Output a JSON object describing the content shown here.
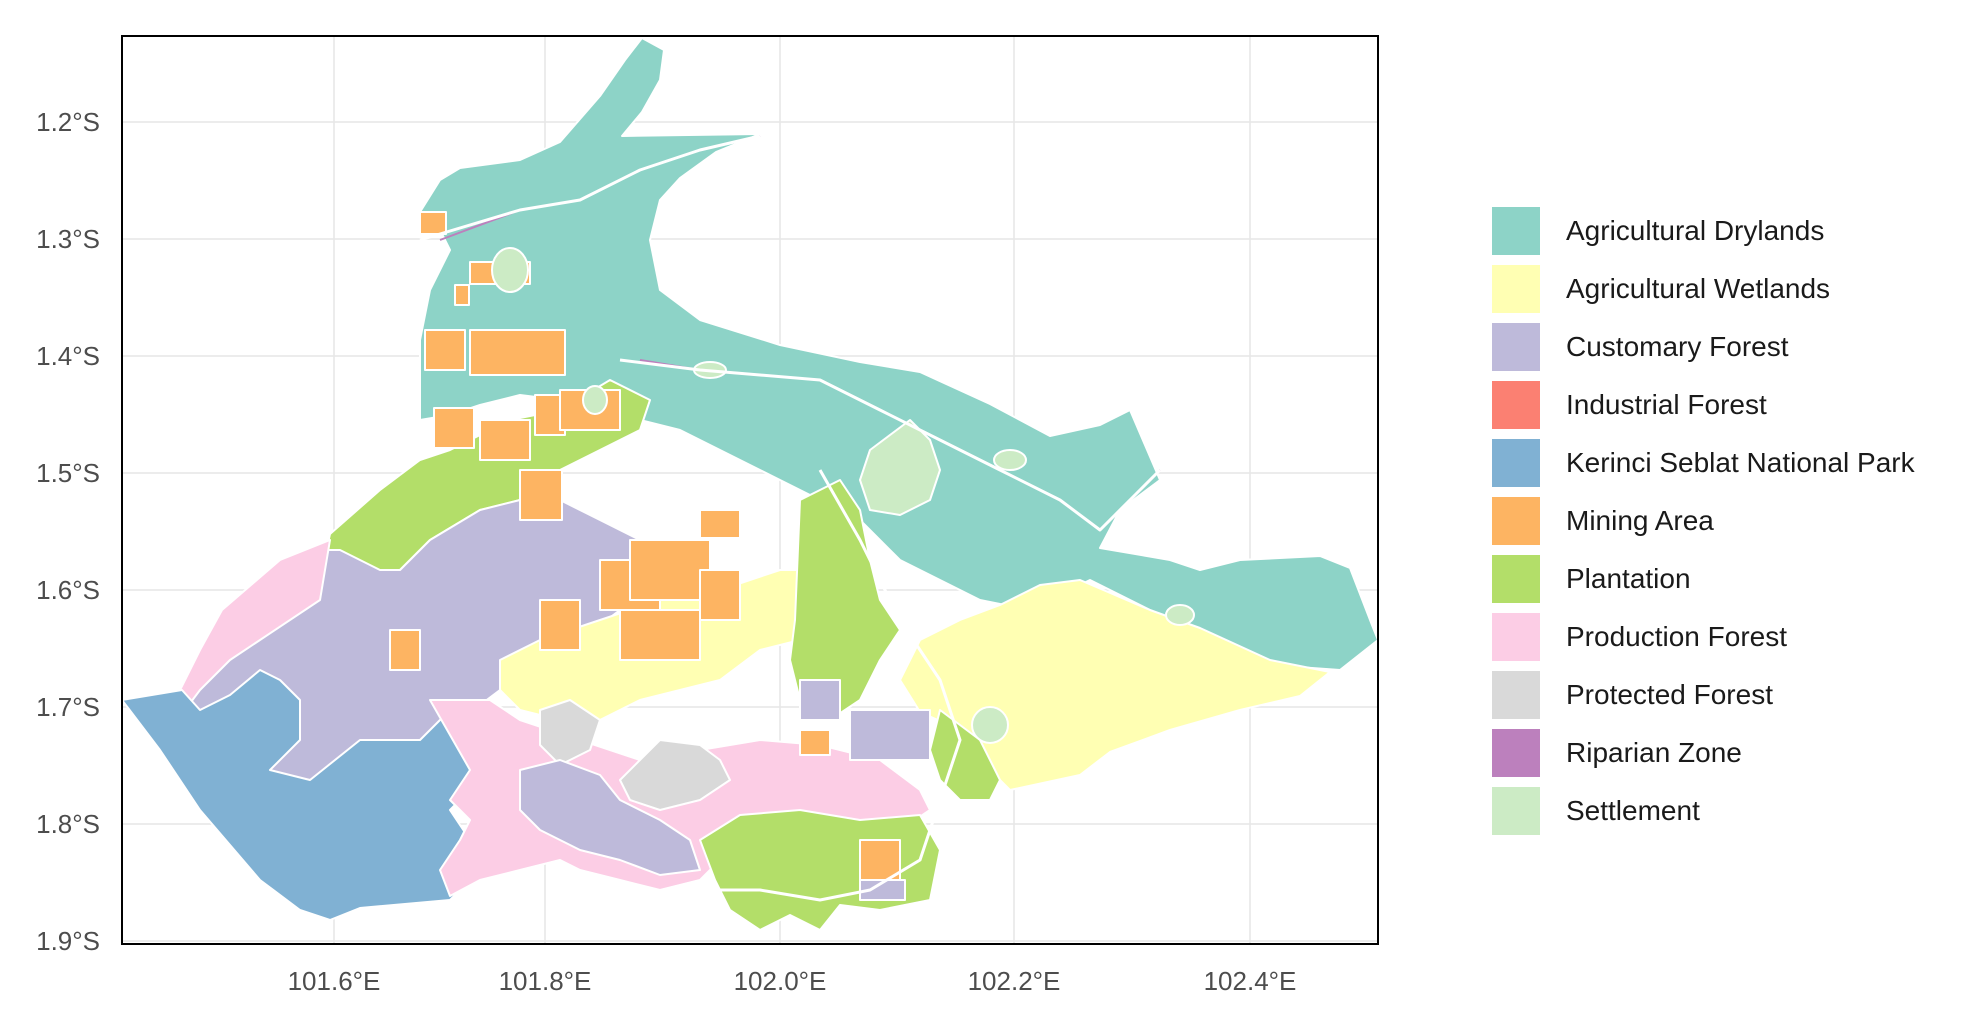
{
  "map": {
    "x_ticks": [
      "101.6°E",
      "101.8°E",
      "102.0°E",
      "102.2°E",
      "102.4°E"
    ],
    "y_ticks": [
      "1.2°S",
      "1.3°S",
      "1.4°S",
      "1.5°S",
      "1.6°S",
      "1.7°S",
      "1.8°S",
      "1.9°S"
    ]
  },
  "legend": {
    "items": [
      {
        "label": "Agricultural Drylands",
        "color": "#8dd3c7"
      },
      {
        "label": "Agricultural Wetlands",
        "color": "#ffffb3"
      },
      {
        "label": "Customary Forest",
        "color": "#bebada"
      },
      {
        "label": "Industrial Forest",
        "color": "#fb8072"
      },
      {
        "label": "Kerinci Seblat National Park",
        "color": "#80b1d3"
      },
      {
        "label": "Mining Area",
        "color": "#fdb462"
      },
      {
        "label": "Plantation",
        "color": "#b3de69"
      },
      {
        "label": "Production Forest",
        "color": "#fccde5"
      },
      {
        "label": "Protected Forest",
        "color": "#d9d9d9"
      },
      {
        "label": "Riparian Zone",
        "color": "#bc80bd"
      },
      {
        "label": "Settlement",
        "color": "#ccebc5"
      }
    ]
  }
}
